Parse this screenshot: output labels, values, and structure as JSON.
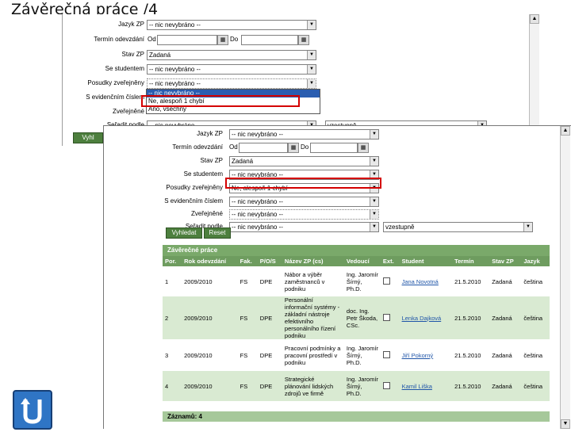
{
  "slide_title": "Závěrečná práce /4",
  "form": {
    "jazyk_label": "Jazyk ZP",
    "jazyk_value": "-- nic nevybráno --",
    "termin_label": "Termín odevzdání",
    "od_label": "Od",
    "do_label": "Do",
    "stav_label": "Stav ZP",
    "stav_value": "Zadaná",
    "se_studentem_label": "Se studentem",
    "se_studentem_value": "-- nic nevybráno --",
    "posudky_label": "Posudky zveřejněny",
    "posudky_value": "-- nic nevybráno --",
    "posudky_value2": "Ne, alespoň 1 chybí",
    "s_evidencnim_label": "S evidenčním číslem",
    "s_evidencnim_value": "-- nic nevybráno --",
    "zverejnene_label": "Zveřejněné",
    "zverejnene_value": "-- nic nevybráno --",
    "sortby_label": "Seřadit podle",
    "sortby_value": "-- nic nevybráno --",
    "sortdir_value": "vzestupně"
  },
  "dropdown_options": [
    "-- nic nevybráno --",
    "Ne, alespoň 1 chybí",
    "Ano, všechny"
  ],
  "buttons": {
    "search": "Vyhledat",
    "reset": "Reset",
    "search_short": "Vyhl"
  },
  "results": {
    "title": "Závěrečné práce",
    "columns": [
      "Por.",
      "Rok odevzdání",
      "Fak.",
      "P/O/S",
      "Název ZP (cs)",
      "Vedoucí",
      "Ext.",
      "Student",
      "Termín",
      "Stav ZP",
      "Jazyk"
    ],
    "rows": [
      {
        "por": "1",
        "rok": "2009/2010",
        "fak": "FS",
        "pos": "DPE",
        "nazev": "Nábor a výběr zaměstnanců v podniku",
        "vedouci": "Ing. Jaromír Šírný, Ph.D.",
        "student": "Jana Novotná",
        "termin": "21.5.2010",
        "stav": "Zadaná",
        "jazyk": "čeština"
      },
      {
        "por": "2",
        "rok": "2009/2010",
        "fak": "FS",
        "pos": "DPE",
        "nazev": "Personální informační systémy - základní nástroje efektivního personálního řízení podniku",
        "vedouci": "doc. Ing. Petr Škoda, CSc.",
        "student": "Lenka Dajková",
        "termin": "21.5.2010",
        "stav": "Zadaná",
        "jazyk": "čeština"
      },
      {
        "por": "3",
        "rok": "2009/2010",
        "fak": "FS",
        "pos": "DPE",
        "nazev": "Pracovní podmínky a pracovní prostředí v podniku",
        "vedouci": "Ing. Jaromír Šírný, Ph.D.",
        "student": "Jiří Pokorný",
        "termin": "21.5.2010",
        "stav": "Zadaná",
        "jazyk": "čeština"
      },
      {
        "por": "4",
        "rok": "2009/2010",
        "fak": "FS",
        "pos": "DPE",
        "nazev": "Strategické plánování lidských zdrojů ve firmě",
        "vedouci": "Ing. Jaromír Šírný, Ph.D.",
        "student": "Kamil Liška",
        "termin": "21.5.2010",
        "stav": "Zadaná",
        "jazyk": "čeština"
      }
    ],
    "footer": "Záznamů: 4"
  }
}
